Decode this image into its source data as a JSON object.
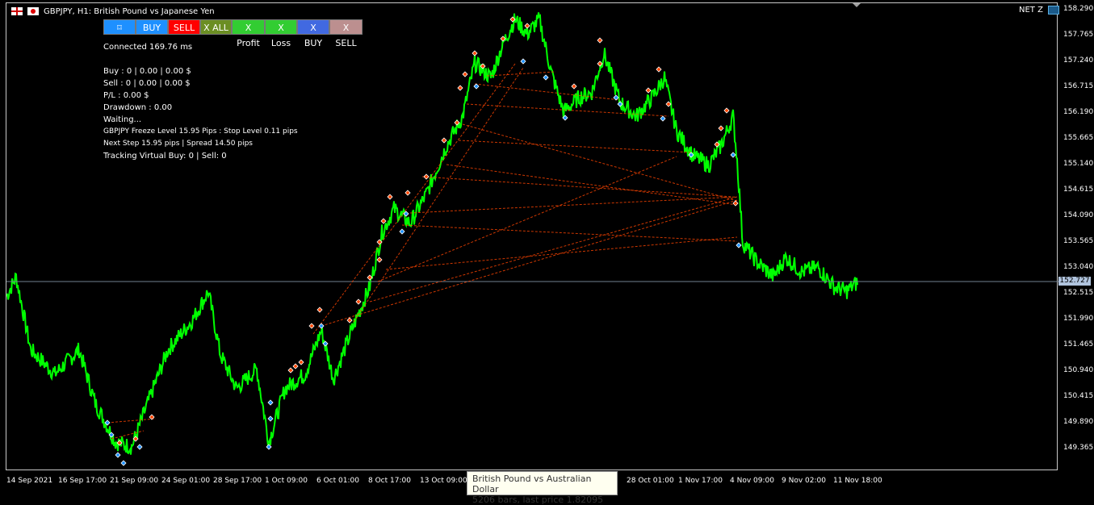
{
  "header": {
    "title": "GBPJPY, H1:  British Pound vs Japanese Yen",
    "account": "NET Z"
  },
  "toolbar": {
    "buttons": [
      {
        "label": "",
        "color": "#1e90ff",
        "icon": "move-icon"
      },
      {
        "label": "BUY",
        "color": "#1e90ff"
      },
      {
        "label": "SELL",
        "color": "#ff0000"
      },
      {
        "label": "X ALL",
        "color": "#6b8e23"
      },
      {
        "label": "X Profit",
        "color": "#32cd32"
      },
      {
        "label": "X Loss",
        "color": "#32cd32"
      },
      {
        "label": "X BUY",
        "color": "#4169e1"
      },
      {
        "label": "X SELL",
        "color": "#bc8f8f"
      }
    ]
  },
  "info": {
    "connected": "Connected 169.76 ms",
    "buy": "Buy : 0 | 0.00 | 0.00 $",
    "sell": "Sell : 0 | 0.00 | 0.00 $",
    "pl": "P/L : 0.00 $",
    "drawdown": "Drawdown : 0.00",
    "status": "Waiting...",
    "freeze": "GBPJPY Freeze Level  15.95 Pips : Stop Level 0.11 pips",
    "next_step": "Next Step   15.95 pips   | Spread 14.50 pips",
    "tracking": "Tracking Virtual Buy: 0 | Sell: 0"
  },
  "price_axis": [
    "158.290",
    "157.765",
    "157.240",
    "156.715",
    "156.190",
    "155.665",
    "155.140",
    "154.615",
    "154.090",
    "153.565",
    "153.040",
    "152.515",
    "151.990",
    "151.465",
    "150.940",
    "150.415",
    "149.890",
    "149.365"
  ],
  "current_price": "152.727",
  "time_axis": [
    "14 Sep 2021",
    "16 Sep 17:00",
    "21 Sep 09:00",
    "24 Sep 01:00",
    "28 Sep 17:00",
    "1 Oct 09:00",
    "6 Oct 01:00",
    "8 Oct 17:00",
    "13 Oct 09:00",
    "28 Oct 01:00",
    "1 Nov 17:00",
    "4 Nov 09:00",
    "9 Nov 02:00",
    "11 Nov 18:00"
  ],
  "tooltip": {
    "line1": "British Pound vs Australian Dollar",
    "line2": "5206 bars, last price 1.82095"
  },
  "colors": {
    "line": "#00ff00",
    "trade_lines": "#ff4500",
    "buy_marker": "#1e90ff",
    "sell_marker": "#ff4500"
  },
  "chart_data": {
    "type": "line",
    "series": [
      {
        "x": [
          "14 Sep 2021",
          "16 Sep 17:00",
          "21 Sep 09:00",
          "24 Sep 01:00",
          "28 Sep 17:00",
          "1 Oct 09:00",
          "6 Oct 01:00",
          "8 Oct 17:00",
          "13 Oct 09:00",
          "28 Oct 01:00",
          "1 Nov 17:00",
          "4 Nov 09:00",
          "9 Nov 02:00",
          "11 Nov 18:00"
        ],
        "y": [
          152.5,
          150.9,
          149.5,
          151.6,
          150.3,
          150.1,
          151.5,
          153.6,
          156.5,
          157.0,
          155.2,
          153.4,
          152.9,
          152.7
        ]
      }
    ],
    "ylim": [
      149.1,
      158.4
    ]
  }
}
